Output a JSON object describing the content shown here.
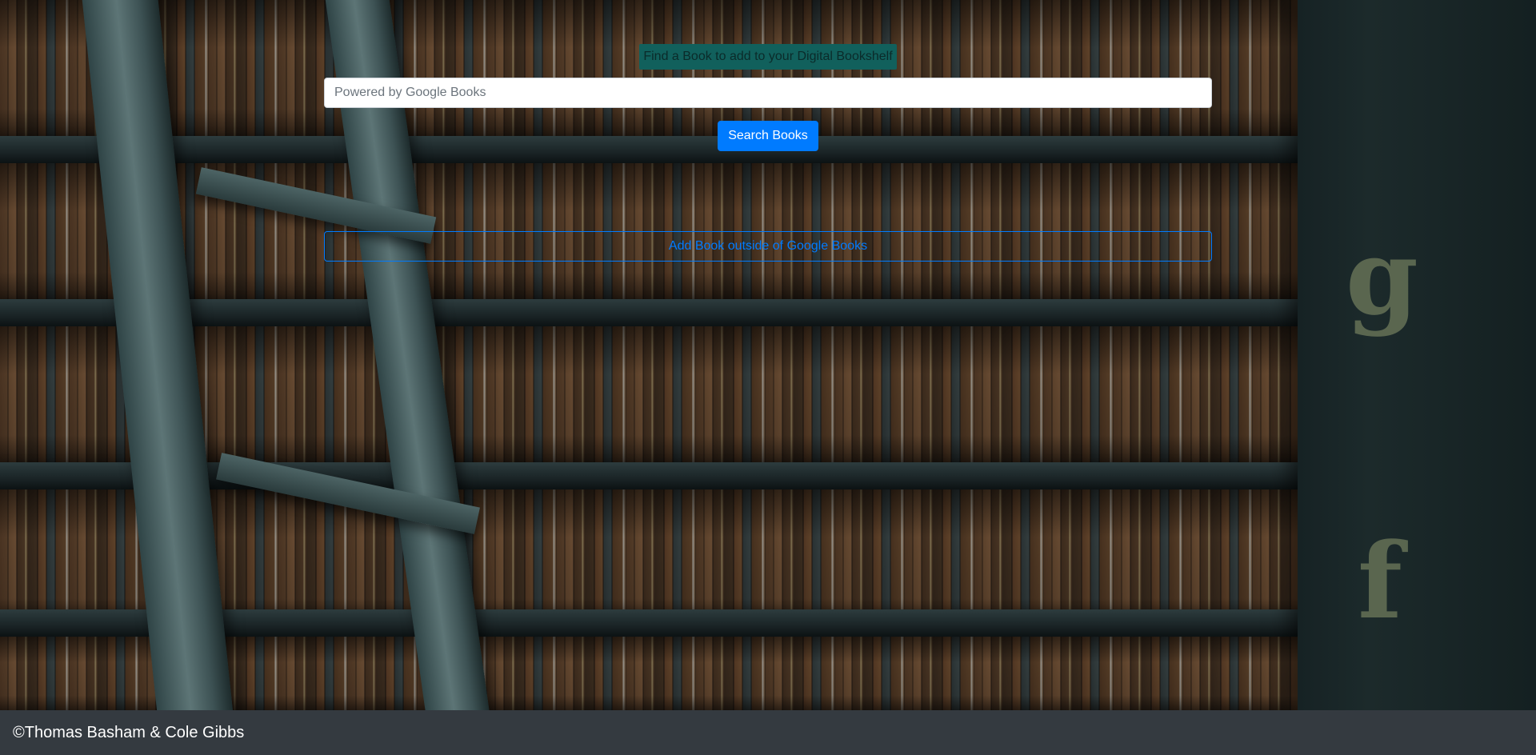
{
  "header": {
    "title": "Find a Book to add to your Digital Bookshelf"
  },
  "search": {
    "placeholder": "Powered by Google Books",
    "value": ""
  },
  "actions": {
    "search_label": "Search Books",
    "add_outside_label": "Add Book outside of Google Books"
  },
  "footer": {
    "copyright": "©Thomas Basham & Cole Gibbs"
  },
  "colors": {
    "primary": "#007bff",
    "heading_bg": "#11605c",
    "footer_bg": "#343a40"
  },
  "background": {
    "image": "library-bookshelf-with-ladder",
    "pillar_letters": [
      "g",
      "f"
    ]
  }
}
